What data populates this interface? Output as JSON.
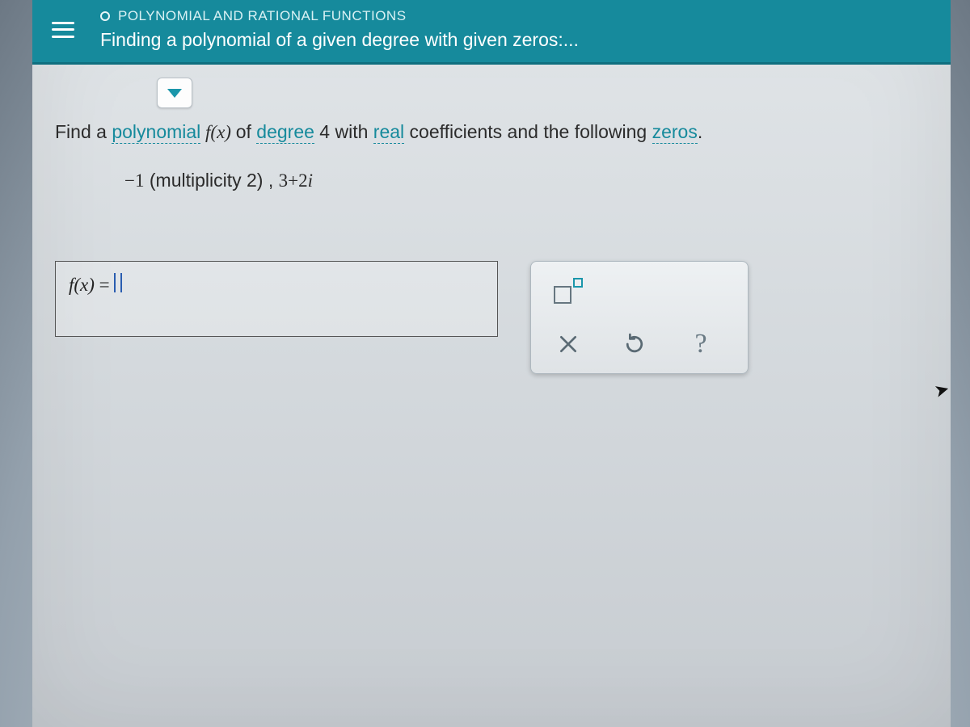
{
  "header": {
    "category": "POLYNOMIAL AND RATIONAL FUNCTIONS",
    "title": "Finding a polynomial of a given degree with given zeros:..."
  },
  "problem": {
    "pre": "Find a ",
    "link_polynomial": "polynomial",
    "fx": " f(x) ",
    "of": "of ",
    "link_degree": "degree",
    "degree_text": " 4 with ",
    "link_real": "real",
    "post": " coefficients and the following ",
    "link_zeros": "zeros",
    "end": "."
  },
  "zeros": {
    "z1": "−1",
    "mult": " (multiplicity 2) ,  ",
    "z2": "3+2",
    "i": "i"
  },
  "answer": {
    "lhs": "f(x)",
    "eq": " = "
  },
  "tools": {
    "exponent": "exponent",
    "clear": "clear",
    "redo": "redo",
    "help": "?"
  }
}
